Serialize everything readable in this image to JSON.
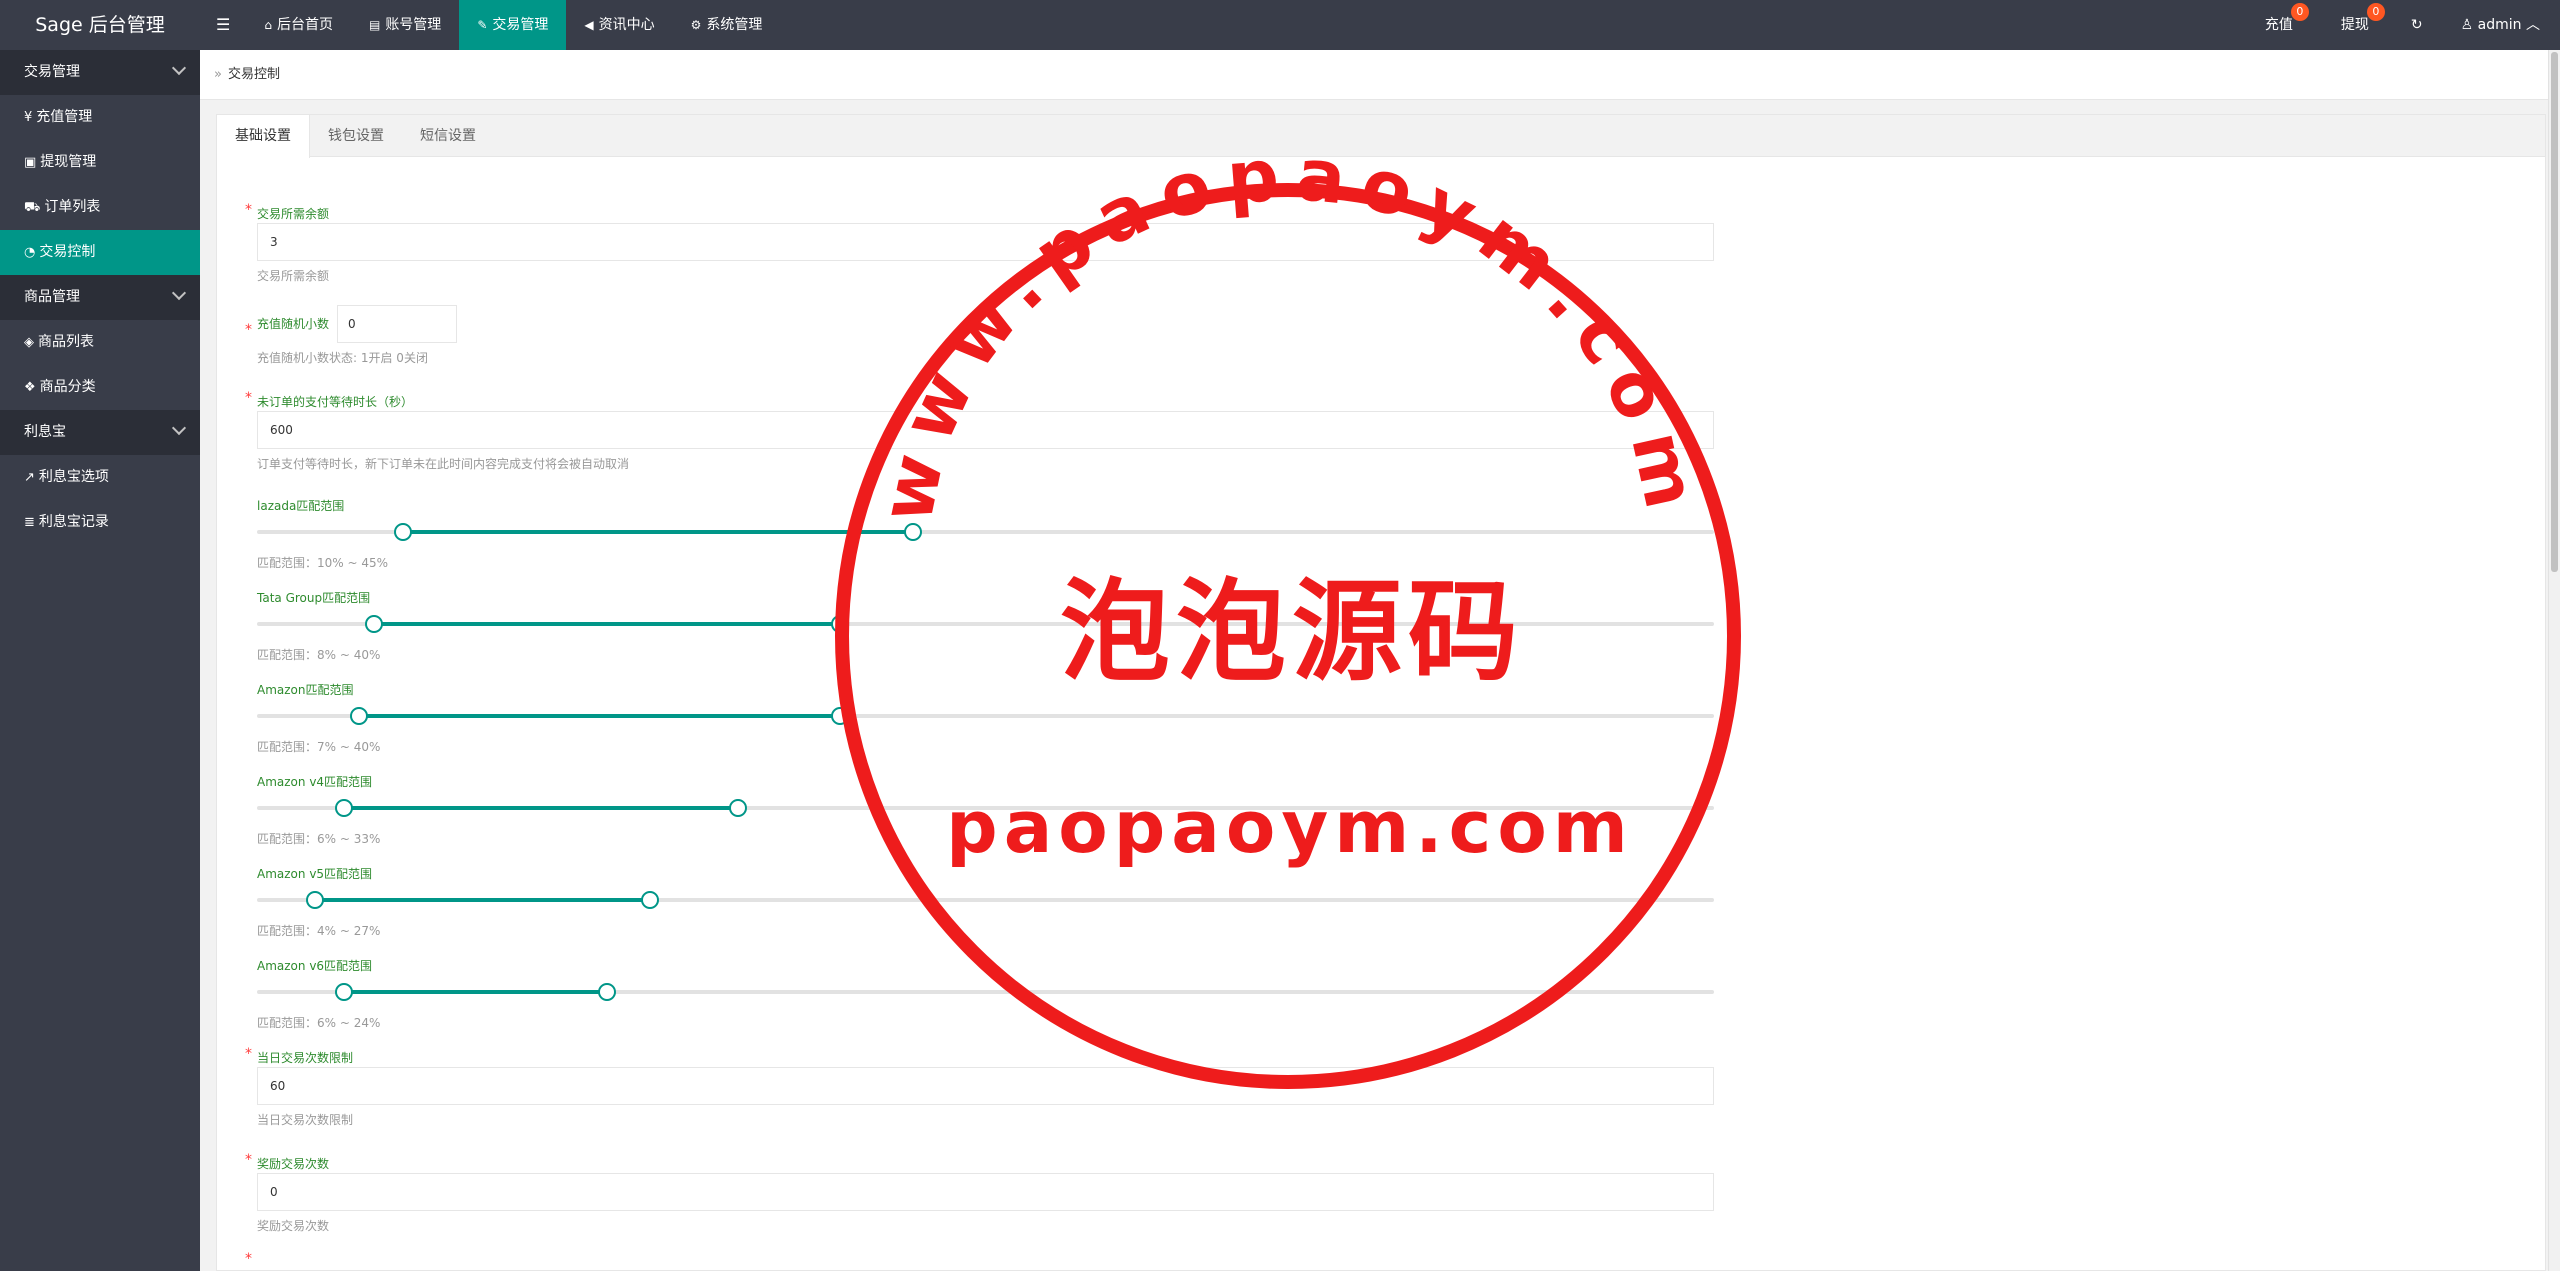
{
  "app": {
    "title": "Sage 后台管理"
  },
  "top_nav": {
    "items": [
      {
        "label": "后台首页",
        "icon": "home-icon",
        "glyph": "⌂"
      },
      {
        "label": "账号管理",
        "icon": "idcard-icon",
        "glyph": "▤"
      },
      {
        "label": "交易管理",
        "icon": "gavel-icon",
        "glyph": "✎"
      },
      {
        "label": "资讯中心",
        "icon": "bullhorn-icon",
        "glyph": "◀"
      },
      {
        "label": "系统管理",
        "icon": "gears-icon",
        "glyph": "⚙"
      }
    ],
    "right": {
      "recharge_label": "充值",
      "recharge_count": "0",
      "withdraw_label": "提现",
      "withdraw_count": "0",
      "user": "admin"
    }
  },
  "sidebar": {
    "groups": [
      {
        "label": "交易管理",
        "items": [
          {
            "label": "充值管理",
            "glyph": "¥"
          },
          {
            "label": "提现管理",
            "glyph": "▣"
          },
          {
            "label": "订单列表",
            "glyph": "⛟"
          },
          {
            "label": "交易控制",
            "glyph": "◔"
          }
        ]
      },
      {
        "label": "商品管理",
        "items": [
          {
            "label": "商品列表",
            "glyph": "◈"
          },
          {
            "label": "商品分类",
            "glyph": "❖"
          }
        ]
      },
      {
        "label": "利息宝",
        "items": [
          {
            "label": "利息宝选项",
            "glyph": "↗"
          },
          {
            "label": "利息宝记录",
            "glyph": "≣"
          }
        ]
      }
    ]
  },
  "breadcrumb": {
    "current": "交易控制"
  },
  "tabs": [
    "基础设置",
    "钱包设置",
    "短信设置"
  ],
  "form": {
    "min_balance": {
      "label": "交易所需余额",
      "value": "3",
      "hint": "交易所需余额"
    },
    "random_decimal": {
      "label": "充值随机小数",
      "value": "0",
      "hint": "充值随机小数状态: 1开启 0关闭"
    },
    "pay_wait": {
      "label": "未订单的支付等待时长（秒）",
      "value": "600",
      "hint": "订单支付等待时长，新下订单未在此时间内容完成支付将会被自动取消"
    },
    "sliders": [
      {
        "label": "lazada匹配范围",
        "hint": "匹配范围：10% ~ 45%",
        "min": 10,
        "max": 45
      },
      {
        "label": "Tata Group匹配范围",
        "hint": "匹配范围：8% ~ 40%",
        "min": 8,
        "max": 40
      },
      {
        "label": "Amazon匹配范围",
        "hint": "匹配范围：7% ~ 40%",
        "min": 7,
        "max": 40
      },
      {
        "label": "Amazon v4匹配范围",
        "hint": "匹配范围：6% ~ 33%",
        "min": 6,
        "max": 33
      },
      {
        "label": "Amazon v5匹配范围",
        "hint": "匹配范围：4% ~ 27%",
        "min": 4,
        "max": 27
      },
      {
        "label": "Amazon v6匹配范围",
        "hint": "匹配范围：6% ~ 24%",
        "min": 6,
        "max": 24
      }
    ],
    "daily_limit": {
      "label": "当日交易次数限制",
      "value": "60",
      "hint": "当日交易次数限制"
    },
    "bonus_count": {
      "label": "奖励交易次数",
      "value": "0",
      "hint": "奖励交易次数"
    }
  },
  "watermark": {
    "arc_text": "www.paopaoym.com",
    "cn_text": "泡泡源码",
    "domain_text": "paopaoym.com",
    "color": "#ee1c1c"
  },
  "colors": {
    "accent": "#009688",
    "header": "#393d49",
    "badge": "#ff5722"
  }
}
